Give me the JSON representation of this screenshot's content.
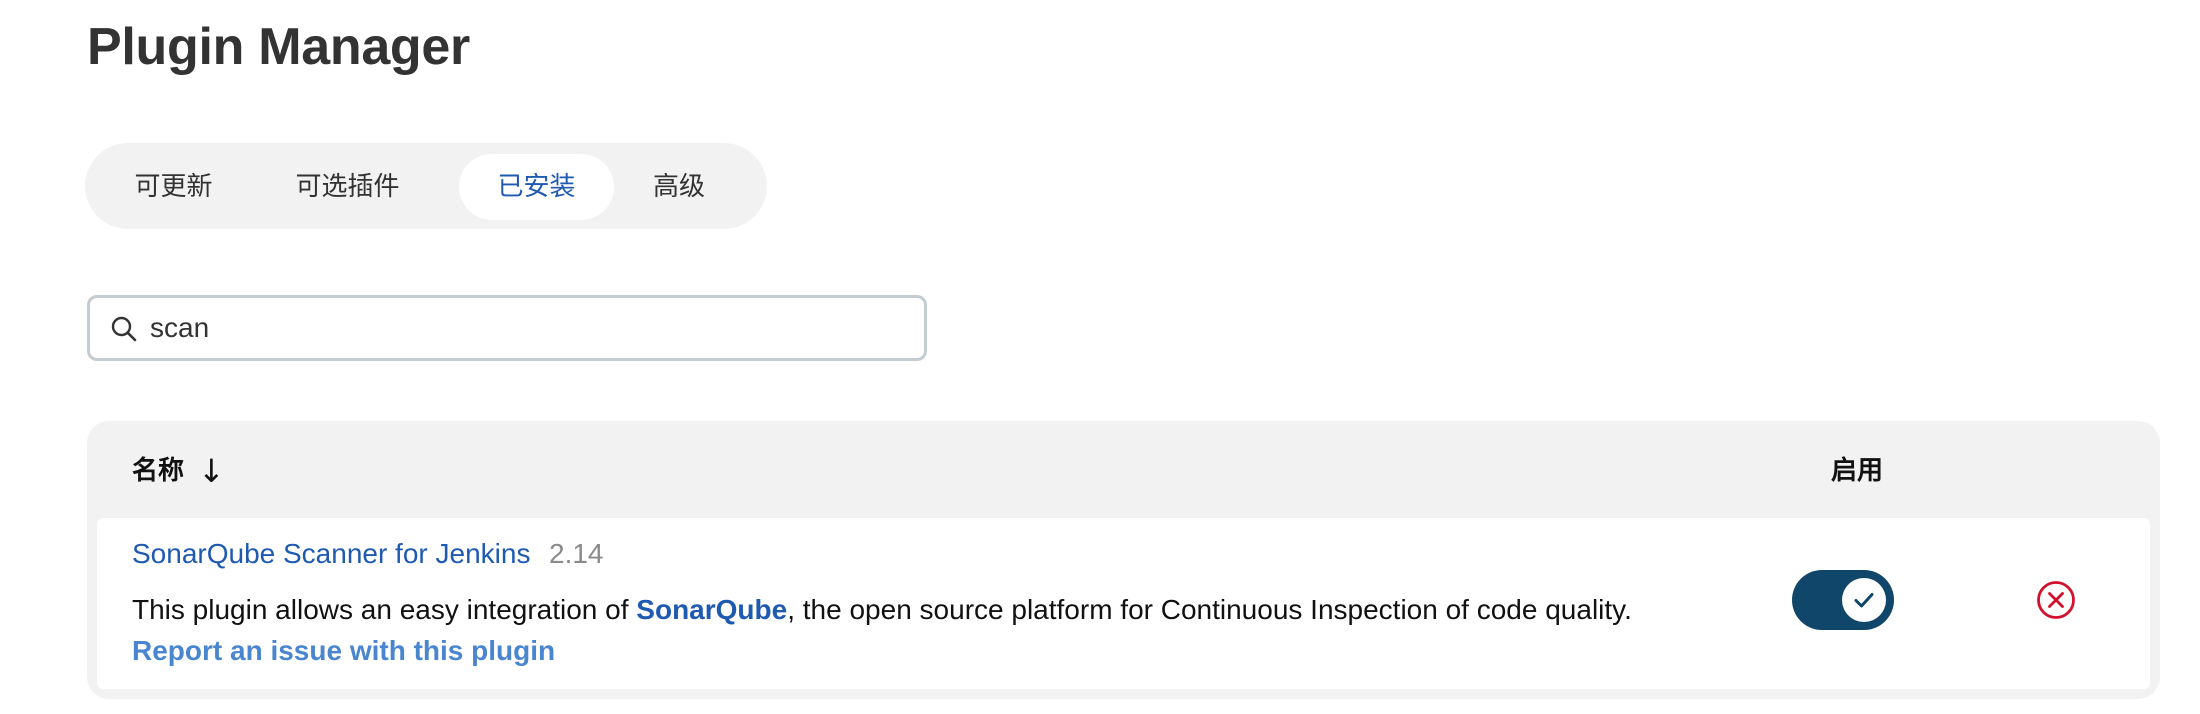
{
  "page": {
    "title": "Plugin Manager"
  },
  "tabs": [
    {
      "label": "可更新",
      "active": false
    },
    {
      "label": "可选插件",
      "active": false
    },
    {
      "label": "已安装",
      "active": true
    },
    {
      "label": "高级",
      "active": false
    }
  ],
  "search": {
    "value": "scan",
    "icon": "search-icon"
  },
  "table": {
    "columns": {
      "name": "名称",
      "sort_indicator": "↓",
      "enabled": "启用"
    },
    "rows": [
      {
        "name": "SonarQube Scanner for Jenkins",
        "version": "2.14",
        "description_before": "This plugin allows an easy integration of ",
        "description_link": "SonarQube",
        "description_after": ", the open source platform for Continuous Inspection of code quality.",
        "report_link": "Report an issue with this plugin",
        "enabled": true
      }
    ]
  },
  "colors": {
    "accent": "#1f5ab1",
    "toggle_on": "#0f4669",
    "danger": "#d2112c",
    "link_light": "#4a86cf"
  }
}
